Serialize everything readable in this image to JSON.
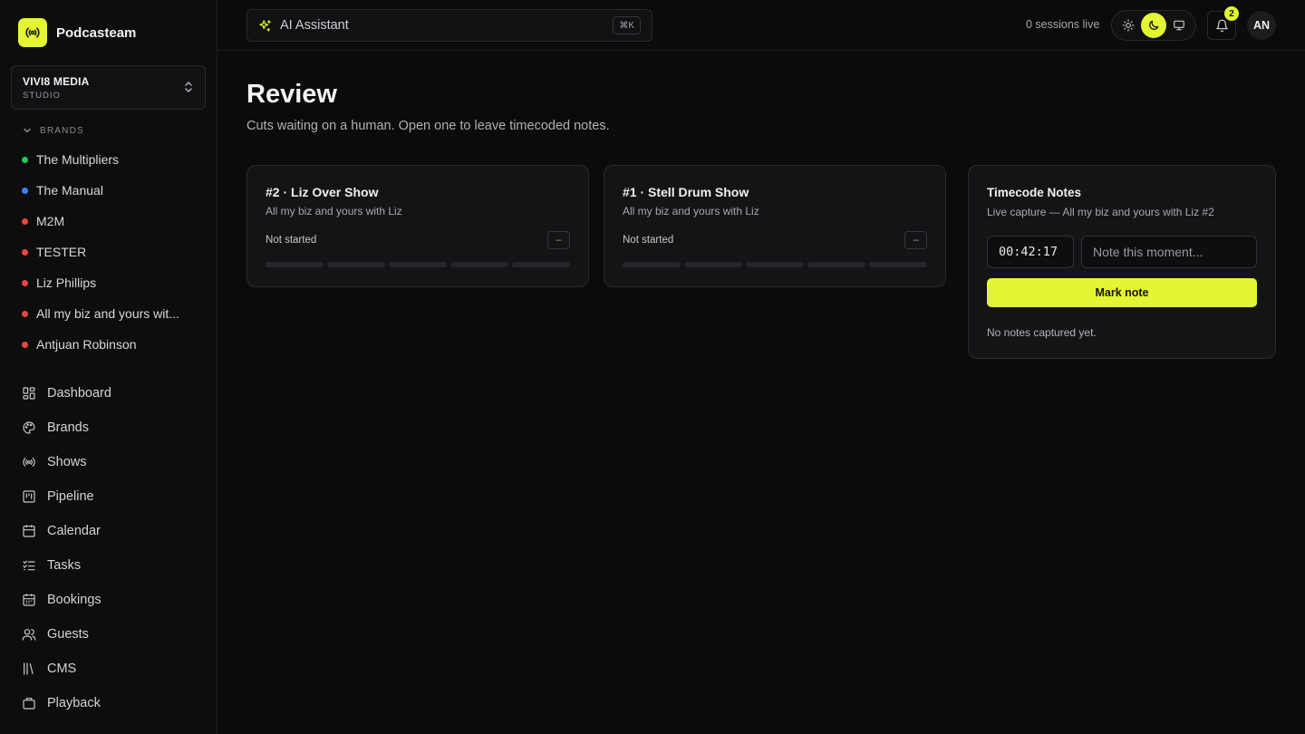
{
  "app": {
    "name": "Podcasteam",
    "accent": "#e4f533"
  },
  "workspace": {
    "name": "VIVI8 MEDIA",
    "type": "STUDIO"
  },
  "sidebar": {
    "brands_heading": "BRANDS",
    "brands": [
      {
        "label": "The Multipliers",
        "color": "#22c55e"
      },
      {
        "label": "The Manual",
        "color": "#3b82f6"
      },
      {
        "label": "M2M",
        "color": "#ef4444"
      },
      {
        "label": "TESTER",
        "color": "#ef4444"
      },
      {
        "label": "Liz Phillips",
        "color": "#ef4444"
      },
      {
        "label": "All my biz and yours wit...",
        "color": "#ef4444"
      },
      {
        "label": "Antjuan Robinson",
        "color": "#ef4444"
      }
    ],
    "nav": [
      {
        "label": "Dashboard",
        "icon": "dashboard-icon"
      },
      {
        "label": "Brands",
        "icon": "palette-icon"
      },
      {
        "label": "Shows",
        "icon": "broadcast-icon"
      },
      {
        "label": "Pipeline",
        "icon": "kanban-icon"
      },
      {
        "label": "Calendar",
        "icon": "calendar-icon"
      },
      {
        "label": "Tasks",
        "icon": "checklist-icon"
      },
      {
        "label": "Bookings",
        "icon": "calendar-check-icon"
      },
      {
        "label": "Guests",
        "icon": "users-icon"
      },
      {
        "label": "CMS",
        "icon": "library-icon"
      },
      {
        "label": "Playback",
        "icon": "briefcase-icon"
      }
    ]
  },
  "topbar": {
    "ai_label": "AI Assistant",
    "shortcut": "⌘K",
    "sessions": "0 sessions live",
    "notifications_count": "2",
    "avatar_initials": "AN",
    "theme_active": "dark"
  },
  "page": {
    "title": "Review",
    "subtitle": "Cuts waiting on a human. Open one to leave timecoded notes."
  },
  "cards": [
    {
      "title": "#2 · Liz Over Show",
      "subtitle": "All my biz and yours with Liz",
      "status": "Not started",
      "action": "–",
      "progress_segments": 5,
      "progress_done": 0
    },
    {
      "title": "#1 · Stell Drum Show",
      "subtitle": "All my biz and yours with Liz",
      "status": "Not started",
      "action": "–",
      "progress_segments": 5,
      "progress_done": 0
    }
  ],
  "notes_panel": {
    "title": "Timecode Notes",
    "subtitle": "Live capture — All my biz and yours with Liz #2",
    "timecode": "00:42:17",
    "note_placeholder": "Note this moment...",
    "button_label": "Mark note",
    "empty_text": "No notes captured yet."
  }
}
